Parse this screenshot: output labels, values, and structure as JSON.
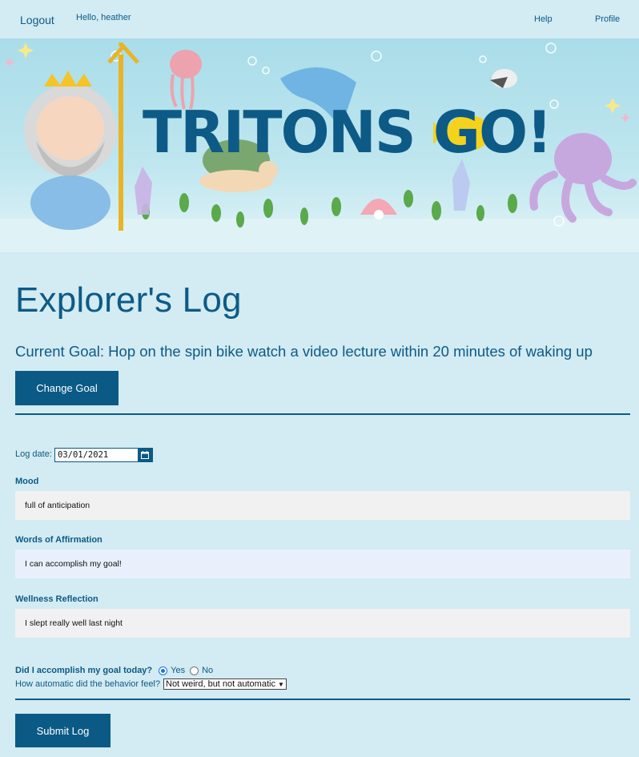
{
  "nav": {
    "logout": "Logout",
    "greeting": "Hello, heather",
    "help": "Help",
    "profile": "Profile"
  },
  "banner": {
    "logo_text": "TRITONS GO!"
  },
  "page": {
    "title": "Explorer's Log",
    "current_goal": "Current Goal: Hop on the spin bike watch a video lecture within 20 minutes of waking up",
    "change_goal_button": "Change Goal"
  },
  "form": {
    "log_date_label": "Log date:",
    "log_date_value": "03/01/2021",
    "mood_label": "Mood",
    "mood_value": "full of anticipation",
    "affirmation_label": "Words of Affirmation",
    "affirmation_value": "I can accomplish my goal!",
    "wellness_label": "Wellness Reflection",
    "wellness_value": "I slept really well last night",
    "accomplished_label": "Did I accomplish my goal today?",
    "accomplished_yes": "Yes",
    "accomplished_no": "No",
    "accomplished_selected": "Yes",
    "automatic_label": "How automatic did the behavior feel?",
    "automatic_selected": "Not weird, but not automatic",
    "submit_button": "Submit Log"
  },
  "colors": {
    "background": "#d3ebf2",
    "primary": "#0a5a85",
    "field_bg": "#f1f1f1"
  }
}
